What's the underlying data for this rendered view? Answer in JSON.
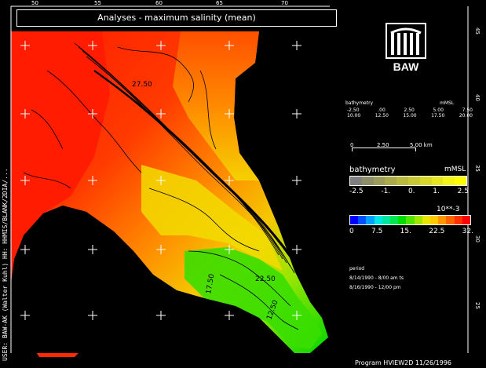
{
  "title": "Analyses - maximum salinity (mean)",
  "top_ticks": [
    "50",
    "55",
    "60",
    "65",
    "70"
  ],
  "right_ticks": [
    "45",
    "40",
    "35",
    "30",
    "25"
  ],
  "left_credit": "USER: BAW-AK (Walter Kuhl)  HH: HHMIS/BLANK/2DIA/...",
  "logo_text": "BAW",
  "legend": {
    "bathymetry_header": {
      "label": "bathymetry",
      "unit": "mMSL",
      "row1": [
        "-2.50",
        ".00",
        "2.50",
        "5.00",
        "7.50"
      ],
      "row2": [
        "10.00",
        "12.50",
        "15.00",
        "17.50",
        "20.00"
      ]
    },
    "scalebar": {
      "labels": [
        "0",
        "2.50",
        "5.00 km"
      ]
    },
    "bathymetry": {
      "label": "bathymetry",
      "unit": "mMSL",
      "ticks": [
        "-2.5",
        "-1.",
        "0.",
        "1.",
        "2.5"
      ],
      "colors": [
        "#7f7f7f",
        "#8d8d6a",
        "#9c9c5a",
        "#aaaa4a",
        "#b9b940",
        "#c8c835",
        "#d7d72a",
        "#e6e620",
        "#f5f515",
        "#ffff00"
      ]
    },
    "salinity": {
      "unit": "10**-3",
      "ticks": [
        "0",
        "7.5",
        "15.",
        "22.5",
        "32."
      ],
      "colors": [
        "#0000ff",
        "#0050ff",
        "#00a0ff",
        "#00e6e6",
        "#00e6a0",
        "#00e650",
        "#00dc00",
        "#50e600",
        "#a0e600",
        "#e6e600",
        "#ffc800",
        "#ff9600",
        "#ff6400",
        "#ff3200",
        "#ff0000"
      ]
    },
    "period": {
      "heading": "period",
      "line1": "8/14/1990 - 8/00 am ts",
      "line2": "8/16/1990 - 12/00 pm"
    }
  },
  "contour_labels": [
    "27.50",
    "22.50",
    "17.50",
    "12.50"
  ],
  "footer": "Program  HVIEW2D   11/26/1996",
  "colors": {
    "background": "#000000",
    "high_salinity": "#ff2a00",
    "mid_salinity": "#f5a000",
    "low_salinity": "#2adc00"
  }
}
